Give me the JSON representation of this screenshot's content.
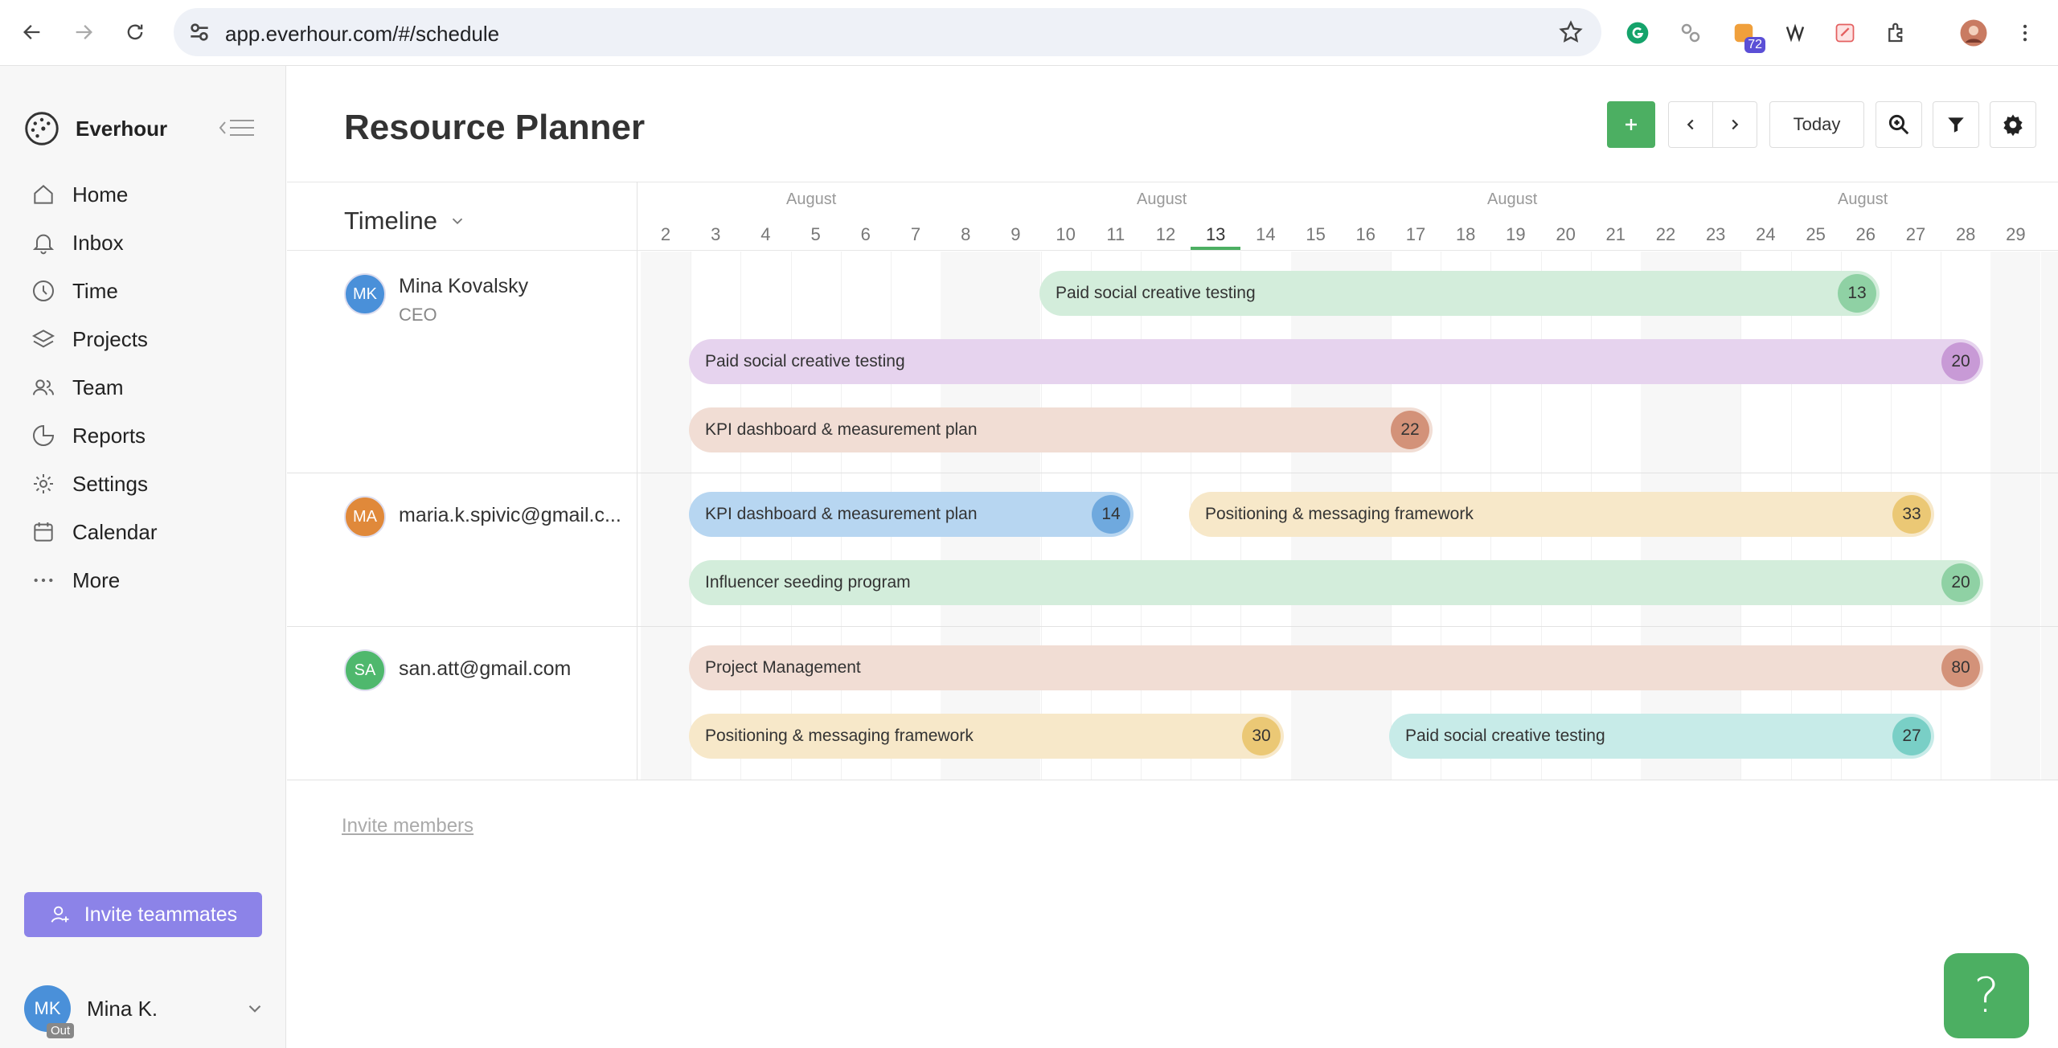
{
  "browser": {
    "url": "app.everhour.com/#/schedule",
    "ext_badge": "72"
  },
  "sidebar": {
    "brand": "Everhour",
    "items": [
      {
        "label": "Home",
        "icon": "home-icon"
      },
      {
        "label": "Inbox",
        "icon": "bell-icon"
      },
      {
        "label": "Time",
        "icon": "clock-icon"
      },
      {
        "label": "Projects",
        "icon": "layers-icon"
      },
      {
        "label": "Team",
        "icon": "team-icon"
      },
      {
        "label": "Reports",
        "icon": "pie-icon"
      },
      {
        "label": "Settings",
        "icon": "gear-icon"
      },
      {
        "label": "Calendar",
        "icon": "calendar-icon"
      },
      {
        "label": "More",
        "icon": "more-icon"
      }
    ],
    "invite_label": "Invite teammates",
    "user": {
      "initials": "MK",
      "name": "Mina K.",
      "status": "Out"
    }
  },
  "page": {
    "title": "Resource Planner",
    "today_label": "Today",
    "timeline_label": "Timeline",
    "invite_members": "Invite members"
  },
  "calendar": {
    "months": [
      "August",
      "August",
      "August",
      "August"
    ],
    "days": [
      "2",
      "3",
      "4",
      "5",
      "6",
      "7",
      "8",
      "9",
      "10",
      "11",
      "12",
      "13",
      "14",
      "15",
      "16",
      "17",
      "18",
      "19",
      "20",
      "21",
      "22",
      "23",
      "24",
      "25",
      "26",
      "27",
      "28",
      "29",
      "3"
    ],
    "today_day": "13"
  },
  "members": [
    {
      "initials": "MK",
      "name": "Mina Kovalsky",
      "role": "CEO",
      "color": "#4a90d9",
      "bars": [
        {
          "label": "Paid social creative testing",
          "count": "13",
          "bg": "#d3eddb",
          "badge": "#8fd1a4"
        },
        {
          "label": "Paid social creative testing",
          "count": "20",
          "bg": "#e6d3ee",
          "badge": "#c89ad6"
        },
        {
          "label": "KPI dashboard & measurement plan",
          "count": "22",
          "bg": "#f1ddd4",
          "badge": "#d39279"
        }
      ]
    },
    {
      "initials": "MA",
      "name": "maria.k.spivic@gmail.c...",
      "role": "",
      "color": "#e0893a",
      "bars": [
        {
          "label": "KPI dashboard & measurement plan",
          "count": "14",
          "bg": "#b7d6f1",
          "badge": "#6fa9de"
        },
        {
          "label": "Positioning & messaging framework",
          "count": "33",
          "bg": "#f7e8c9",
          "badge": "#ebc875"
        },
        {
          "label": "Influencer seeding program",
          "count": "20",
          "bg": "#d3eddb",
          "badge": "#8fd1a4"
        }
      ]
    },
    {
      "initials": "SA",
      "name": "san.att@gmail.com",
      "role": "",
      "color": "#4fb86d",
      "bars": [
        {
          "label": "Project Management",
          "count": "80",
          "bg": "#f1ddd4",
          "badge": "#d39279"
        },
        {
          "label": "Positioning & messaging framework",
          "count": "30",
          "bg": "#f7e8c9",
          "badge": "#ebc875"
        },
        {
          "label": "Paid social creative testing",
          "count": "27",
          "bg": "#c7ebe8",
          "badge": "#79cfc6"
        }
      ]
    }
  ],
  "help": {
    "label": "?"
  }
}
